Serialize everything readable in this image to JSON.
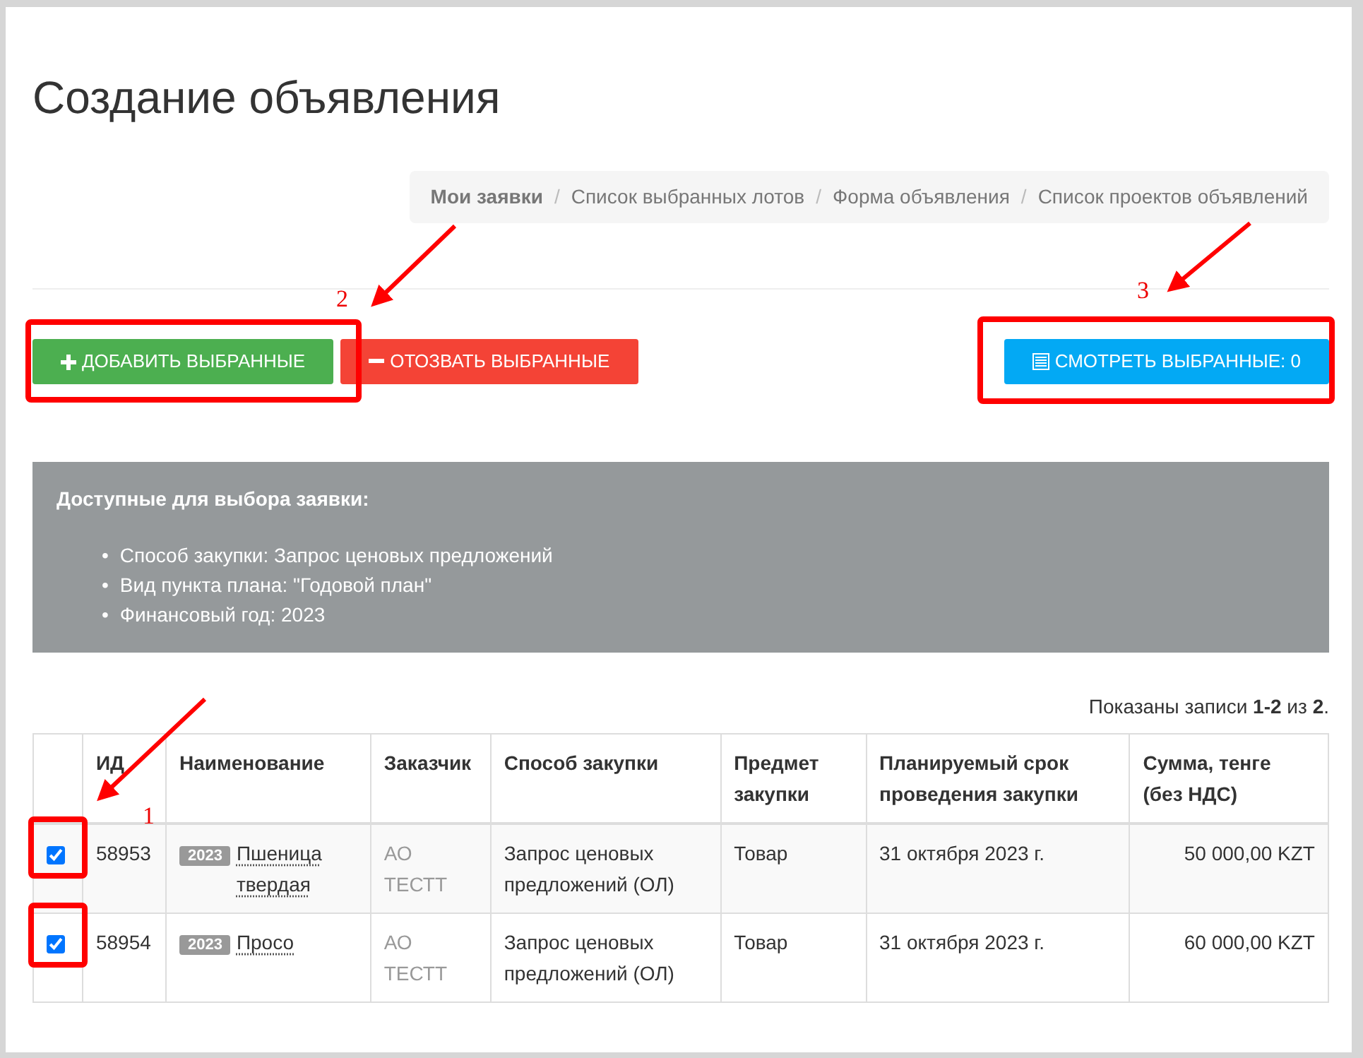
{
  "title": "Создание объявления",
  "breadcrumb": [
    {
      "label": "Мои заявки",
      "active": true
    },
    {
      "separator": "/",
      "label": "Список выбранных лотов",
      "active": false
    },
    {
      "separator": "/",
      "label": "Форма объявления",
      "active": false
    },
    {
      "separator": "/",
      "label": "Список проектов объявлений",
      "active": false
    }
  ],
  "buttons": [
    {
      "kind": "add",
      "label": "ДОБАВИТЬ ВЫБРАННЫЕ"
    },
    {
      "kind": "remove",
      "label": "ОТОЗВАТЬ ВЫБРАННЫЕ"
    },
    {
      "kind": "view",
      "label": "СМОТРЕТЬ ВЫБРАННЫЕ: 0"
    }
  ],
  "info": {
    "heading": "Доступные для выбора заявки:",
    "items": [
      {
        "bullet": "•",
        "text": "Способ закупки: Запрос ценовых предложений"
      },
      {
        "bullet": "•",
        "text": "Вид пункта плана: \"Годовой план\""
      },
      {
        "bullet": "•",
        "text": "Финансовый год: 2023"
      }
    ]
  },
  "summary": "Показаны записи **1-2** из **2**.",
  "table": {
    "columns": [
      "ИД",
      "Наименование",
      "Заказчик",
      "Способ закупки",
      "Предмет закупки",
      "Планируемый срок проведения закупки",
      "Сумма, тенге (без НДС)"
    ],
    "rows": [
      {
        "checked": true,
        "id": "58953",
        "year": "2023",
        "name": "Пшеница твердая",
        "customer": "АО ТЕСТТ",
        "method": "Запрос ценовых предложений (ОЛ)",
        "subject": "Товар",
        "date": "31 октября 2023 г.",
        "sum": "50 000,00 KZT"
      },
      {
        "checked": true,
        "id": "58954",
        "year": "2023",
        "name": "Просо",
        "customer": "АО ТЕСТТ",
        "method": "Запрос ценовых предложений (ОЛ)",
        "subject": "Товар",
        "date": "31 октября 2023 г.",
        "sum": "60 000,00 KZT"
      }
    ]
  },
  "annotations": [
    {
      "label": "2"
    },
    {
      "label": "3"
    },
    {
      "label": "1"
    }
  ]
}
